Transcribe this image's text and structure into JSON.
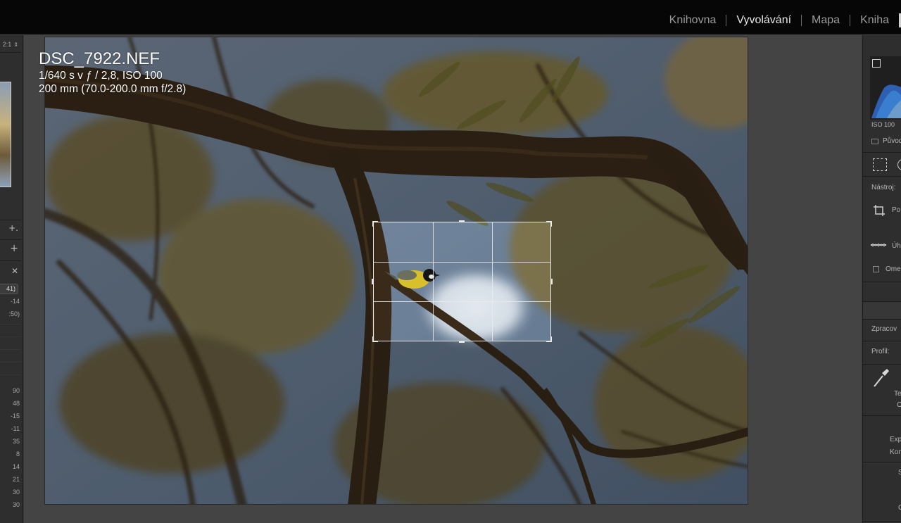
{
  "top_nav": {
    "modules": [
      "Knihovna",
      "Vyvolávání",
      "Mapa",
      "Kniha"
    ],
    "active": "Vyvolávání"
  },
  "left_panel": {
    "zoom_label": "2:1",
    "values_a": [
      "41)",
      "-14",
      ":50)"
    ],
    "values_b": [
      "90",
      "48",
      "-15",
      "-11",
      "35",
      "8",
      "14",
      "21",
      "30",
      "30"
    ]
  },
  "photo_info": {
    "filename": "DSC_7922.NEF",
    "exposure": "1/640 s v ƒ / 2,8, ISO 100",
    "lens": "200 mm (70.0-200.0 mm f/2.8)"
  },
  "right_panel": {
    "iso_label": "ISO 100",
    "original_label": "Původ",
    "tool_label": "Nástroj:",
    "crop_tool_label": "Po",
    "angle_label": "Úh",
    "constrain_label": "Ome",
    "processing_label": "Zpracov",
    "profile_label": "Profil:",
    "wb_temp_label": "Te",
    "wb_tint_label": "O",
    "exposure_label": "Exp",
    "contrast_label": "Kon",
    "label_s": "S",
    "label_c": "C"
  },
  "colors": {
    "background": "#444444",
    "panel": "#2e2e2e",
    "topbar": "#060606",
    "active_module": "#e8e8e8",
    "inactive_module": "#9a9a9a"
  }
}
